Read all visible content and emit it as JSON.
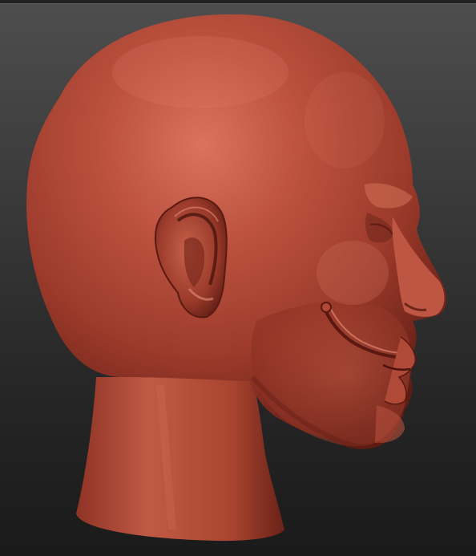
{
  "viewport": {
    "background_top": "#4e4e4e",
    "background_bottom": "#1a1a1a",
    "model_color": "#a63d30",
    "model_highlight": "#d8705e",
    "model_shadow": "#5a1a12"
  },
  "model": {
    "subject": "sculpted-male-head-profile",
    "view": "right-side-profile"
  }
}
